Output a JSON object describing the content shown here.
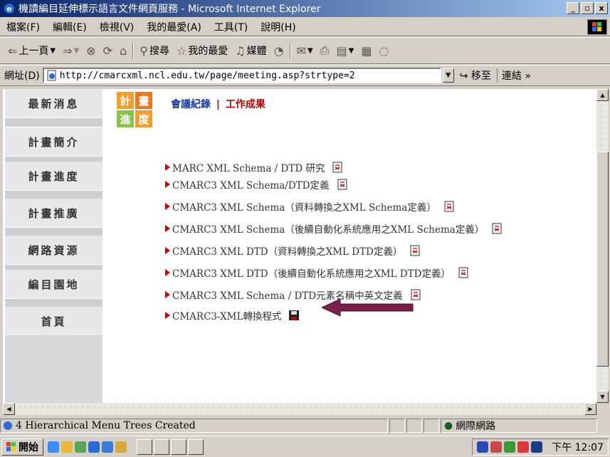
{
  "window": {
    "title": "機讀編目延伸標示語言文件網頁服務 - Microsoft Internet Explorer",
    "buttons": [
      "_",
      "▫",
      "x"
    ]
  },
  "menu": [
    "檔案(F)",
    "編輯(E)",
    "檢視(V)",
    "我的最愛(A)",
    "工具(T)",
    "說明(H)"
  ],
  "toolbar": {
    "back": "上一頁",
    "search": "搜尋",
    "favorites": "我的最愛",
    "media": "媒體"
  },
  "address": {
    "label": "網址(D)",
    "url": "http://cmarcxml.ncl.edu.tw/page/meeting.asp?strtype=2",
    "go": "移至",
    "links": "連結"
  },
  "sidebar": {
    "items": [
      {
        "label": "最新消息"
      },
      {
        "label": "計畫簡介"
      },
      {
        "label": "計畫進度"
      },
      {
        "label": "計畫推廣"
      },
      {
        "label": "網路資源"
      },
      {
        "label": "編目園地"
      },
      {
        "label": "首頁"
      }
    ]
  },
  "logo": {
    "chars": [
      "計",
      "畫",
      "進",
      "度"
    ]
  },
  "tabs": {
    "meeting": "會議紀錄",
    "separator": "|",
    "results": "工作成果"
  },
  "documents": [
    {
      "title": "MARC XML Schema / DTD 研究",
      "icon": "pdf-icon"
    },
    {
      "title": "CMARC3 XML Schema/DTD定義",
      "icon": "pdf-icon"
    },
    {
      "title": "CMARC3 XML Schema（資料轉換之XML Schema定義）",
      "icon": "pdf-icon"
    },
    {
      "title": "CMARC3 XML Schema（後續自動化系統應用之XML Schema定義）",
      "icon": "pdf-icon"
    },
    {
      "title": "CMARC3 XML DTD（資料轉換之XML DTD定義）",
      "icon": "pdf-icon"
    },
    {
      "title": "CMARC3 XML DTD（後續自動化系統應用之XML DTD定義）",
      "icon": "pdf-icon"
    },
    {
      "title": "CMARC3 XML Schema / DTD元素名稱中英文定義",
      "icon": "pdf-icon"
    },
    {
      "title": "CMARC3-XML轉換程式",
      "icon": "save-disk-icon"
    }
  ],
  "status": {
    "text": "4 Hierarchical Menu Trees Created",
    "zone": "網際網路"
  },
  "taskbar": {
    "start": "開始",
    "clock": "下午 12:07"
  },
  "colors": {
    "titlebar": "#0a246a",
    "bullet": "#cc0000",
    "arrow": "#7a1f4a",
    "tab_meeting": "#1a3aa8",
    "tab_results": "#bb0000"
  }
}
